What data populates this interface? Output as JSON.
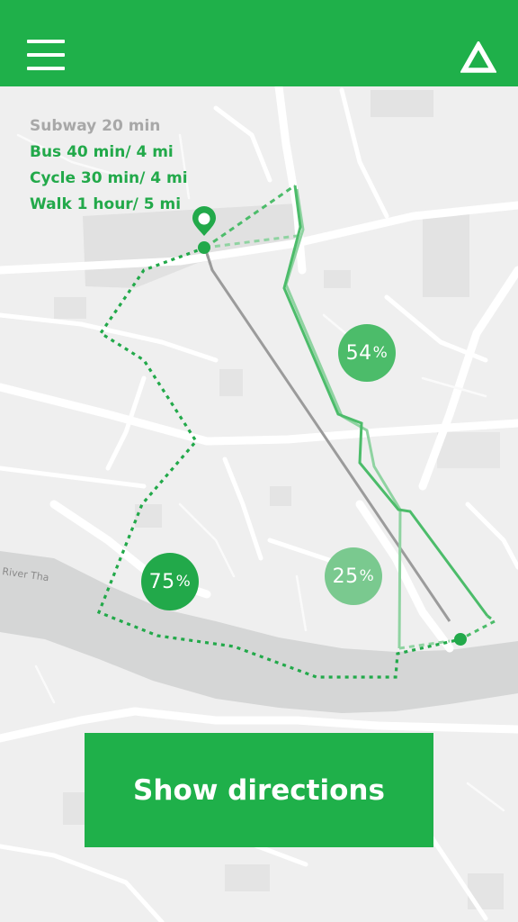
{
  "header": {
    "menu_icon": "hamburger-menu-icon",
    "nav_icon": "triangle-navigation-icon",
    "color": "#1fb04a"
  },
  "legend": [
    {
      "text": "Subway 20 min",
      "color": "#a8a8a8"
    },
    {
      "text": "Bus 40 min/ 4 mi",
      "color": "#22a94a"
    },
    {
      "text": "Cycle 30 min/ 4 mi",
      "color": "#22a94a"
    },
    {
      "text": "Walk 1 hour/ 5 mi",
      "color": "#22a94a"
    }
  ],
  "map": {
    "street_label": "River Tha",
    "origin_icon": "location-pin-icon",
    "badges": [
      {
        "value": "54",
        "unit": "%",
        "color": "#4cbc6a"
      },
      {
        "value": "25",
        "unit": "%",
        "color": "#7ac98f"
      },
      {
        "value": "75",
        "unit": "%",
        "color": "#22a94a"
      }
    ]
  },
  "cta": {
    "label": "Show directions"
  }
}
